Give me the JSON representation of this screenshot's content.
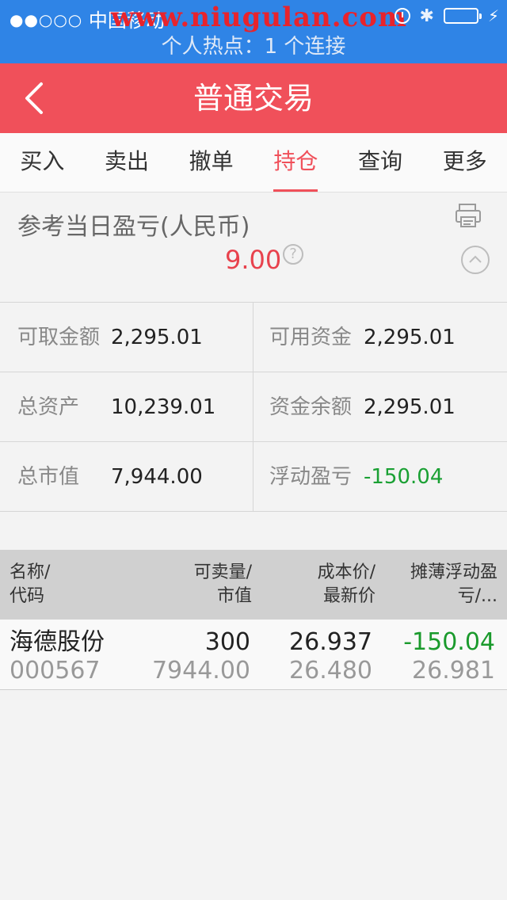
{
  "status_bar": {
    "carrier": "中国移动",
    "watermark": "www.niugulan.com",
    "hotspot_text": "个人热点：1 个连接"
  },
  "nav": {
    "title": "普通交易"
  },
  "tabs": [
    {
      "label": "买入"
    },
    {
      "label": "卖出"
    },
    {
      "label": "撤单"
    },
    {
      "label": "持仓"
    },
    {
      "label": "查询"
    },
    {
      "label": "更多"
    }
  ],
  "profit": {
    "label": "参考当日盈亏(人民币)",
    "value": "9.00"
  },
  "summary": [
    {
      "key": "可取金额",
      "value": "2,295.01"
    },
    {
      "key": "可用资金",
      "value": "2,295.01"
    },
    {
      "key": "总资产",
      "value": "10,239.01"
    },
    {
      "key": "资金余额",
      "value": "2,295.01"
    },
    {
      "key": "总市值",
      "value": "7,944.00"
    },
    {
      "key": "浮动盈亏",
      "value": "-150.04"
    }
  ],
  "table": {
    "headers": [
      "名称/\n代码",
      "可卖量/\n市值",
      "成本价/\n最新价",
      "摊薄浮动盈\n亏/..."
    ],
    "rows": [
      {
        "name": "海德股份",
        "code": "000567",
        "qty": "300",
        "market_value": "7944.00",
        "cost": "26.937",
        "latest": "26.480",
        "pl": "-150.04",
        "pl_sub": "26.981"
      }
    ]
  },
  "colors": {
    "status_bar": "#2f84e6",
    "nav_bar": "#f0505a",
    "gain_red": "#e8424d",
    "loss_green": "#1aa033"
  }
}
